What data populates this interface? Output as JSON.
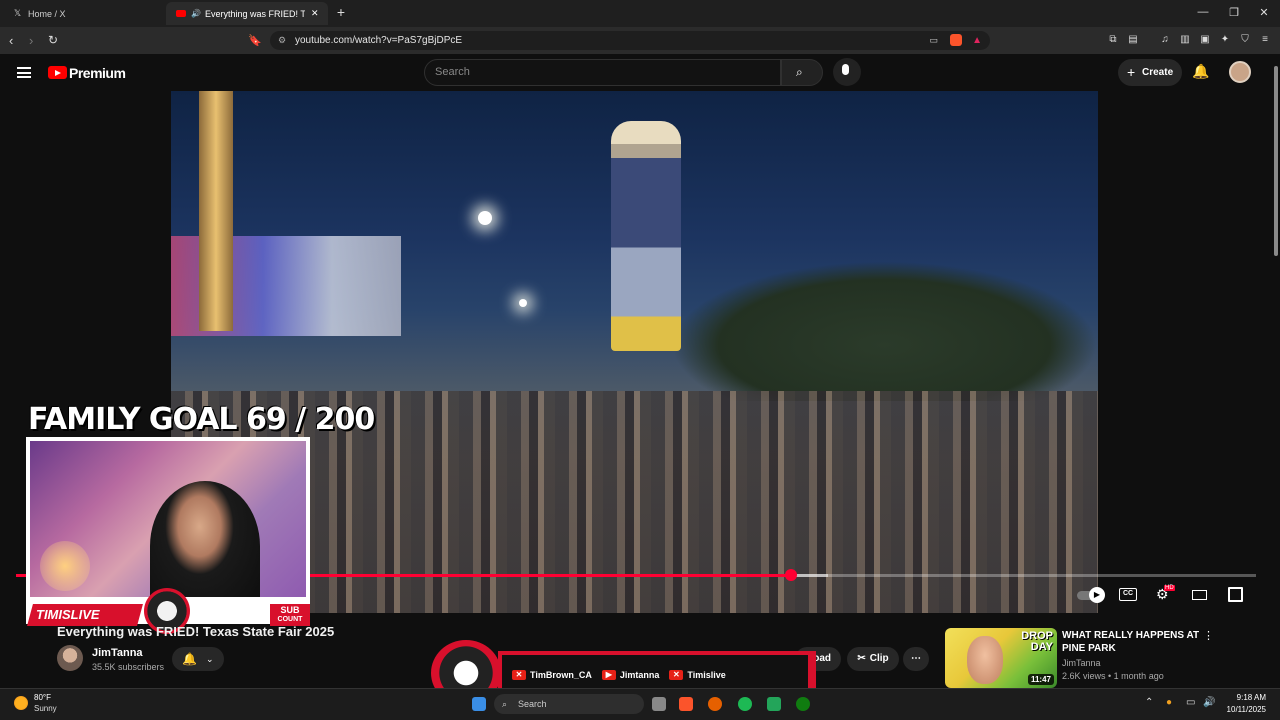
{
  "browser": {
    "tabs": [
      {
        "label": "Home / X",
        "icon": "x-logo-icon"
      },
      {
        "label": "Everything was FRIED! Texas S",
        "icon": "youtube-icon"
      }
    ],
    "new_tab": "+",
    "url": "youtube.com/watch?v=PaS7gBjDPcE"
  },
  "youtube": {
    "brand": "Premium",
    "search_placeholder": "Search",
    "create_label": "Create"
  },
  "player": {
    "progress_fraction": 0.625,
    "buffered_fraction": 0.655,
    "quality_badge": "HD"
  },
  "stream_overlay": {
    "goal_text": "FAMILY GOAL 69 / 200",
    "brand_label": "TIMISLIVE",
    "sub_count_line1": "SUB",
    "sub_count_line2": "COUNT",
    "socials": [
      {
        "platform": "x-icon",
        "handle": "TimBrown_CA"
      },
      {
        "platform": "youtube-icon",
        "handle": "Jimtanna"
      },
      {
        "platform": "x-icon",
        "handle": "Timislive"
      }
    ]
  },
  "video": {
    "title": "Everything was FRIED! Texas State Fair 2025",
    "channel": "JimTanna",
    "subscribers": "35.5K subscribers",
    "actions": {
      "download_partial": "oad",
      "clip": "Clip",
      "more": "⋯"
    }
  },
  "recommendation": {
    "title": "WHAT REALLY HAPPENS AT PINE PARK",
    "channel": "JimTanna",
    "meta": "2.6K views • 1 month ago",
    "duration": "11:47",
    "thumb_text": "DROP DAY"
  },
  "taskbar": {
    "weather_temp": "80°F",
    "weather_cond": "Sunny",
    "search_placeholder": "Search",
    "time": "9:18 AM",
    "date": "10/11/2025"
  }
}
